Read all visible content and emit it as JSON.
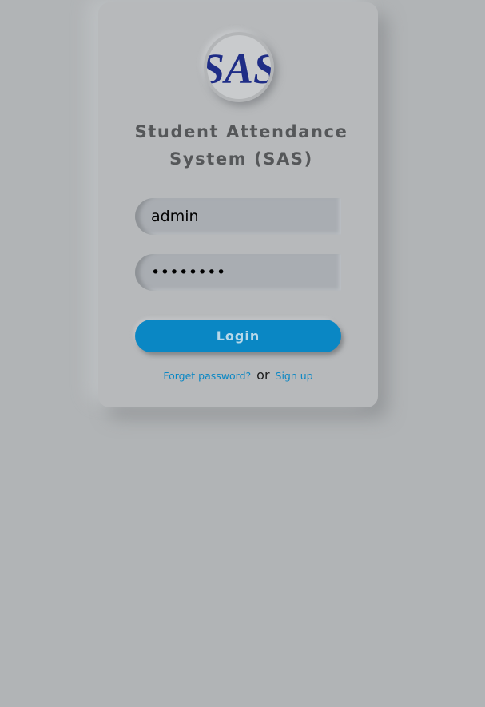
{
  "app": {
    "logo_text": "SAS",
    "title_line1": "Student Attendance",
    "title_line2": "System (SAS)"
  },
  "form": {
    "username_value": "admin",
    "password_value": "password",
    "login_label": "Login"
  },
  "links": {
    "forgot_label": "Forget password?",
    "or_label": "or",
    "signup_label": "Sign up"
  },
  "colors": {
    "background": "#b1b4b6",
    "card": "#b7b9bb",
    "accent": "#0a87c4",
    "logo_text": "#1f2d86",
    "title": "#555759"
  }
}
